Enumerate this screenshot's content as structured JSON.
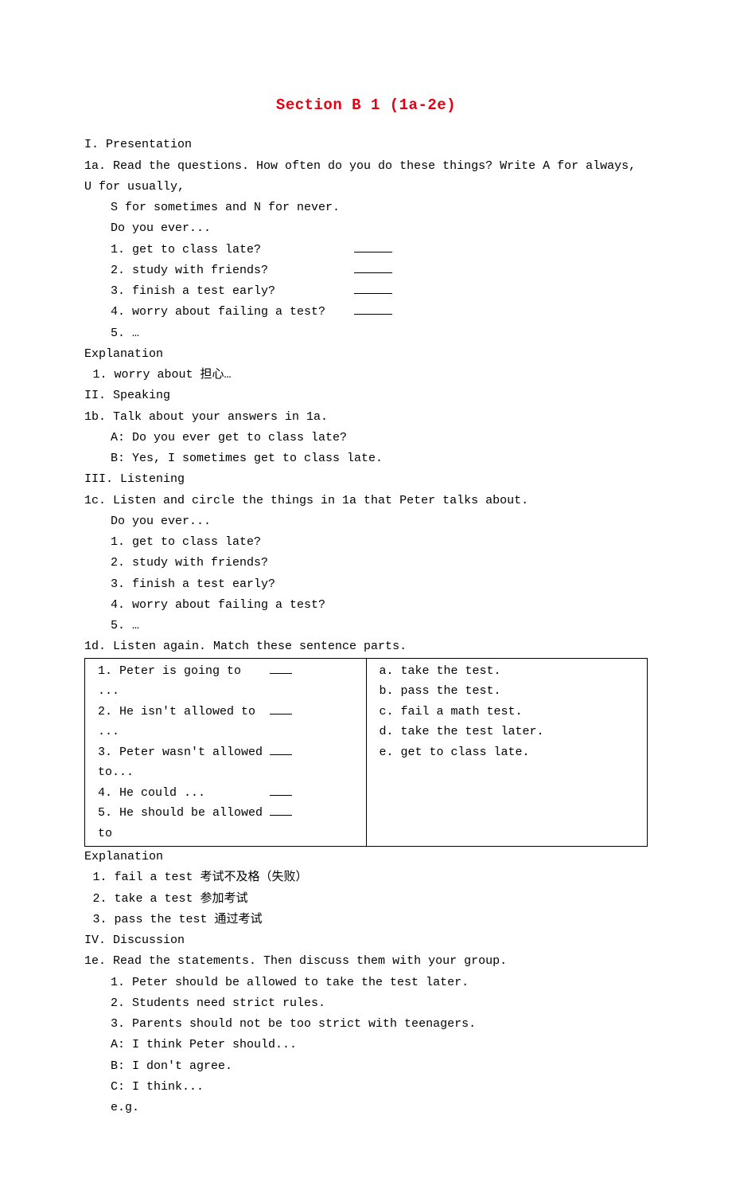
{
  "title": "Section B 1 (1a-2e)",
  "sectionI": {
    "heading": "I. Presentation",
    "prompt_1a": "1a. Read the questions. How often do you do these things? Write A for always, U for usually,",
    "prompt_1a_cont": "S for sometimes and N for never.",
    "do_you_ever": "Do you ever...",
    "q1": "1. get to class late?",
    "q2": "2. study with friends?",
    "q3": "3. finish a test early?",
    "q4": "4. worry about failing a test?",
    "q5": "5. …",
    "explanation_label": "Explanation",
    "expl_1": "1. worry about  担心…"
  },
  "sectionII": {
    "heading": "II. Speaking",
    "prompt_1b": "1b. Talk about your answers in 1a.",
    "lineA": "A: Do you ever get to class late?",
    "lineB": "B: Yes, I sometimes get to class late."
  },
  "sectionIII": {
    "heading": "III. Listening",
    "prompt_1c": "1c. Listen and circle the things in 1a that Peter talks about.",
    "do_you_ever": "Do you ever...",
    "q1": "1. get to class late?",
    "q2": "2. study with friends?",
    "q3": "3. finish a test early?",
    "q4": "4. worry about failing a test?",
    "q5": "5. …",
    "prompt_1d": "1d. Listen again. Match these sentence parts.",
    "match_left": {
      "r1": "1. Peter is going to ...",
      "r2": "2. He isn't allowed to ...",
      "r3": "3. Peter wasn't allowed to...",
      "r4": "4. He could ...",
      "r5": "5. He should be allowed to"
    },
    "match_right": {
      "a": "a. take the test.",
      "b": "b. pass the test.",
      "c": "c. fail a math test.",
      "d": "d. take the test later.",
      "e": "e. get to class late."
    },
    "explanation_label": "Explanation",
    "expl_1": "1. fail a test   考试不及格（失败）",
    "expl_2": "2. take a test   参加考试",
    "expl_3": "3. pass the test  通过考试"
  },
  "sectionIV": {
    "heading": "IV. Discussion",
    "prompt_1e": "1e. Read the statements. Then discuss them with your group.",
    "s1": "1. Peter should be allowed to take the test later.",
    "s2": "2. Students need strict rules.",
    "s3": "3. Parents should not be too strict with teenagers.",
    "lineA": "A: I think Peter should...",
    "lineB": "B: I don't agree.",
    "lineC": "C: I think...",
    "eg": "e.g."
  }
}
